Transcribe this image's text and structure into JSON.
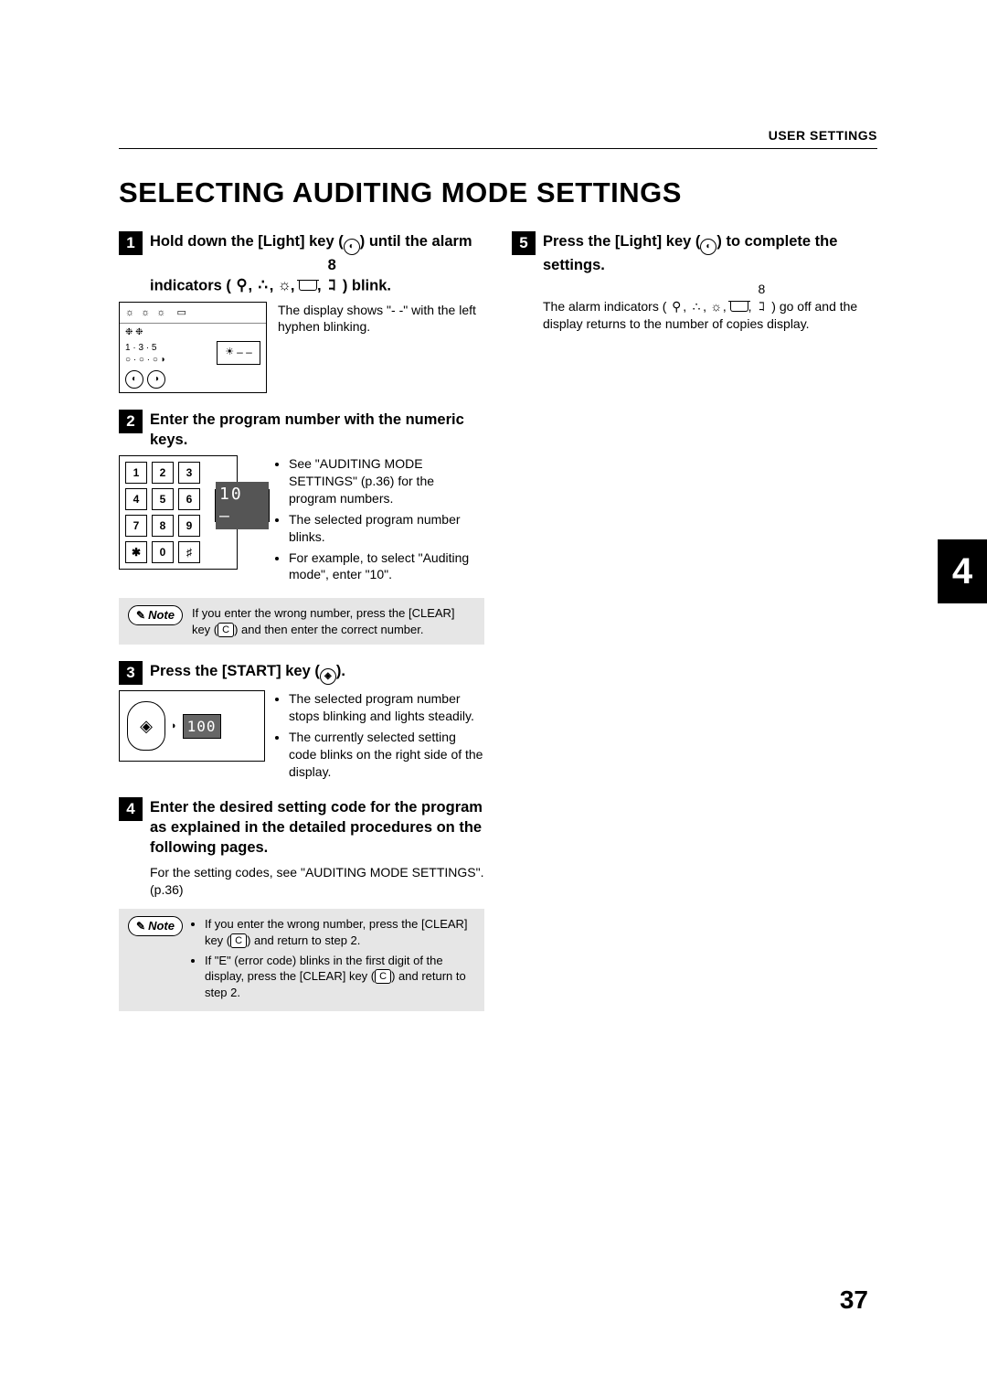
{
  "header": {
    "section": "USER SETTINGS"
  },
  "title": "SELECTING AUDITING MODE SETTINGS",
  "sidebar": {
    "chapter_number": "4"
  },
  "page_number": "37",
  "note_label": "Note",
  "clear_key_label": "C",
  "steps": {
    "s1": {
      "num": "1",
      "head_a": "Hold down the [Light] key (",
      "head_b": ") until the alarm indicators (",
      "head_c": ") blink.",
      "desc": "The display shows \"- -\" with the left hyphen blinking.",
      "panel": {
        "dots": "1 · 3 · 5",
        "range": "○ · ○ · ○ ◗",
        "disp": "– –"
      }
    },
    "s2": {
      "num": "2",
      "head": "Enter the program number with the numeric keys.",
      "bullets": [
        "See \"AUDITING MODE SETTINGS\" (p.36) for the program numbers.",
        "The selected program number blinks.",
        "For example, to select \"Auditing mode\", enter \"10\"."
      ],
      "keypad": [
        "1",
        "2",
        "3",
        "4",
        "5",
        "6",
        "7",
        "8",
        "9",
        "✱",
        "0",
        "♯"
      ],
      "disp": "10 –",
      "note_a": "If you enter the wrong number, press the [CLEAR] key (",
      "note_b": ") and then enter the correct number."
    },
    "s3": {
      "num": "3",
      "head": "Press the [START] key (",
      "head_b": ").",
      "bullets": [
        "The selected program number stops blinking and lights steadily.",
        "The currently selected setting code blinks on the right side of the display."
      ],
      "disp": "100"
    },
    "s4": {
      "num": "4",
      "head": "Enter the desired setting code for the program as explained in the detailed procedures on the following pages.",
      "para": "For the setting codes, see \"AUDITING MODE SETTINGS\". (p.36)",
      "note_b1_a": "If you enter the wrong number, press the [CLEAR] key (",
      "note_b1_b": ") and return to step 2.",
      "note_b2_a": "If \"E\" (error code) blinks in the first digit of the display, press the [CLEAR] key (",
      "note_b2_b": ") and return to step 2."
    },
    "s5": {
      "num": "5",
      "head_a": "Press the [Light] key (",
      "head_b": ") to complete the settings.",
      "para_a": "The alarm indicators (",
      "para_b": ") go off and the display returns to the number of copies display."
    }
  }
}
